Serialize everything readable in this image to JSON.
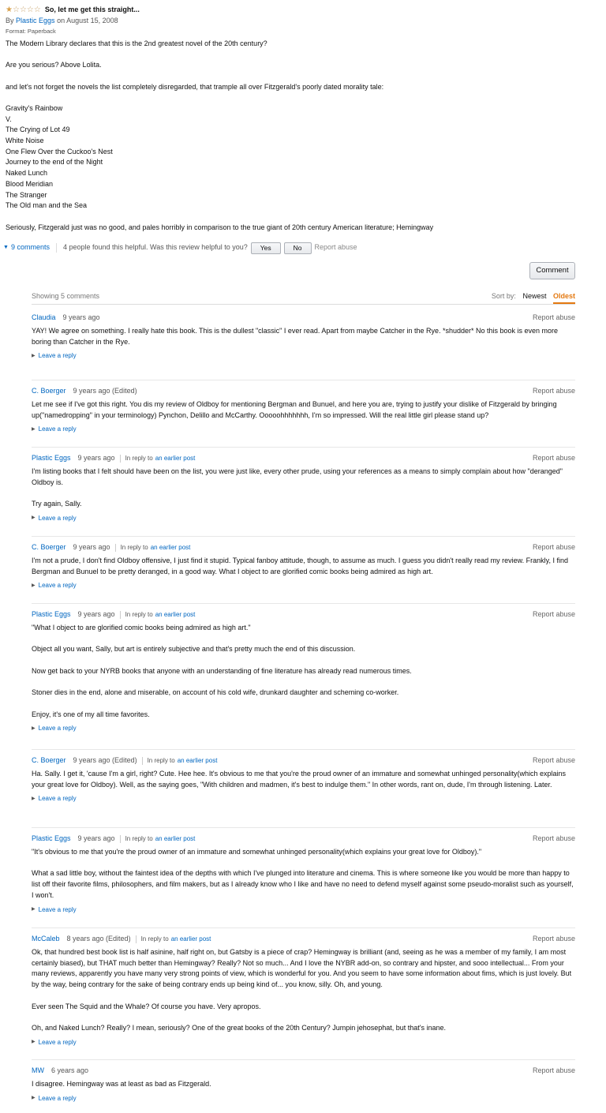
{
  "review": {
    "rating": 1,
    "max_rating": 5,
    "title": "So, let me get this straight...",
    "byline_prefix": "By",
    "author": "Plastic Eggs",
    "date": "on August 15, 2008",
    "format": "Format: Paperback",
    "paragraphs": [
      "The Modern Library declares that this is the 2nd greatest novel of the 20th century?",
      "",
      "Are you serious? Above Lolita.",
      "",
      "and let's not forget the novels the list completely disregarded, that trample all over Fitzgerald's poorly dated morality tale:",
      "",
      "Gravity's Rainbow",
      "V.",
      "The Crying of Lot 49",
      "White Noise",
      "One Flew Over the Cuckoo's Nest",
      "Journey to the end of the Night",
      "Naked Lunch",
      "Blood Meridian",
      "The Stranger",
      "The Old man and the Sea",
      "",
      "Seriously, Fitzgerald just was no good, and pales horribly in comparison to the true giant of 20th century American literature; Hemingway"
    ],
    "comments_link": "9 comments",
    "helpful_text": "4 people found this helpful. Was this review helpful to you?",
    "yes_label": "Yes",
    "no_label": "No",
    "report_label": "Report abuse"
  },
  "comment_button": "Comment",
  "comments_header": {
    "showing": "Showing 5 comments",
    "sort_by": "Sort by:",
    "newest": "Newest",
    "oldest": "Oldest"
  },
  "comments": [
    {
      "author": "Claudia",
      "time": "9 years ago",
      "reply_prefix": "",
      "reply_link": "",
      "report": "Report abuse",
      "paragraphs": [
        "YAY! We agree on something. I really hate this book. This is the dullest \"classic\" I ever read. Apart from maybe Catcher in the Rye. *shudder* No this book is even more boring than Catcher in the Rye."
      ],
      "leave_reply": "Leave a reply"
    },
    {
      "author": "C. Boerger",
      "time": "9 years ago (Edited)",
      "reply_prefix": "",
      "reply_link": "",
      "report": "Report abuse",
      "paragraphs": [
        "Let me see if I've got this right. You dis my review of Oldboy for mentioning Bergman and Bunuel, and here you are, trying to justify your dislike of Fitzgerald by bringing up(\"namedropping\" in your terminology) Pynchon, Delillo and McCarthy. Ooooohhhhhhh, I'm so impressed. Will the real little girl please stand up?"
      ],
      "leave_reply": "Leave a reply"
    },
    {
      "author": "Plastic Eggs",
      "time": "9 years ago",
      "reply_prefix": "In reply to",
      "reply_link": "an earlier post",
      "report": "Report abuse",
      "paragraphs": [
        "I'm listing books that I felt should have been on the list, you were just like, every other prude, using your references as a means to simply complain about how \"deranged\" Oldboy is.",
        "",
        "Try again, Sally."
      ],
      "leave_reply": "Leave a reply"
    },
    {
      "author": "C. Boerger",
      "time": "9 years ago",
      "reply_prefix": "In reply to",
      "reply_link": "an earlier post",
      "report": "Report abuse",
      "paragraphs": [
        "I'm not a prude, I don't find Oldboy offensive, I just find it stupid. Typical fanboy attitude, though, to assume as much. I guess you didn't really read my review. Frankly, I find Bergman and Bunuel to be pretty deranged, in a good way. What I object to are glorified comic books being admired as high art."
      ],
      "leave_reply": "Leave a reply"
    },
    {
      "author": "Plastic Eggs",
      "time": "9 years ago",
      "reply_prefix": "In reply to",
      "reply_link": "an earlier post",
      "report": "Report abuse",
      "paragraphs": [
        "\"What I object to are glorified comic books being admired as high art.\"",
        "",
        "Object all you want, Sally, but art is entirely subjective and that's pretty much the end of this discussion.",
        "",
        "Now get back to your NYRB books that anyone with an understanding of fine literature has already read numerous times.",
        "",
        "Stoner dies in the end, alone and miserable, on account of his cold wife, drunkard daughter and scheming co-worker.",
        "",
        "Enjoy, it's one of my all time favorites."
      ],
      "leave_reply": "Leave a reply"
    },
    {
      "author": "C. Boerger",
      "time": "9 years ago (Edited)",
      "reply_prefix": "In reply to",
      "reply_link": "an earlier post",
      "report": "Report abuse",
      "paragraphs": [
        "Ha. Sally. I get it, 'cause I'm a girl, right? Cute. Hee hee. It's obvious to me that you're the proud owner of an immature and somewhat unhinged personality(which explains your great love for Oldboy). Well, as the saying goes, \"With children and madmen, it's best to indulge them.\" In other words, rant on, dude, I'm through listening. Later."
      ],
      "leave_reply": "Leave a reply"
    },
    {
      "author": "Plastic Eggs",
      "time": "9 years ago",
      "reply_prefix": "In reply to",
      "reply_link": "an earlier post",
      "report": "Report abuse",
      "paragraphs": [
        "\"It's obvious to me that you're the proud owner of an immature and somewhat unhinged personality(which explains your great love for Oldboy).\"",
        "",
        "What a sad little boy, without the faintest idea of the depths with which I've plunged into literature and cinema. This is where someone like you would be more than happy to list off their favorite films, philosophers, and film makers, but as I already know who I like and have no need to defend myself against some pseudo-moralist such as yourself, I won't."
      ],
      "leave_reply": "Leave a reply"
    },
    {
      "author": "McCaleb",
      "time": "8 years ago (Edited)",
      "reply_prefix": "In reply to",
      "reply_link": "an earlier post",
      "report": "Report abuse",
      "paragraphs": [
        "Ok, that hundred best book list is half asinine, half right on, but Gatsby is a piece of crap? Hemingway is brilliant (and, seeing as he was a member of my family, I am most certainly biased), but THAT much better than Hemingway? Really? Not so much... And I love the NYBR add-on, so contrary and hipster, and sooo intellectual... From your many reviews, apparently you have many very strong points of view, which is wonderful for you. And you seem to have some information about fims, which is just lovely. But by the way, being contrary for the sake of being contrary ends up being kind of... you know, silly. Oh, and young.",
        "",
        "Ever seen The Squid and the Whale? Of course you have. Very apropos.",
        "",
        "Oh, and Naked Lunch? Really? I mean, seriously? One of the great books of the 20th Century? Jumpin jehosephat, but that's inane."
      ],
      "leave_reply": "Leave a reply"
    },
    {
      "author": "MW",
      "time": "6 years ago",
      "reply_prefix": "",
      "reply_link": "",
      "report": "Report abuse",
      "paragraphs": [
        "I disagree. Hemingway was at least as bad as Fitzgerald."
      ],
      "leave_reply": "Leave a reply"
    }
  ]
}
